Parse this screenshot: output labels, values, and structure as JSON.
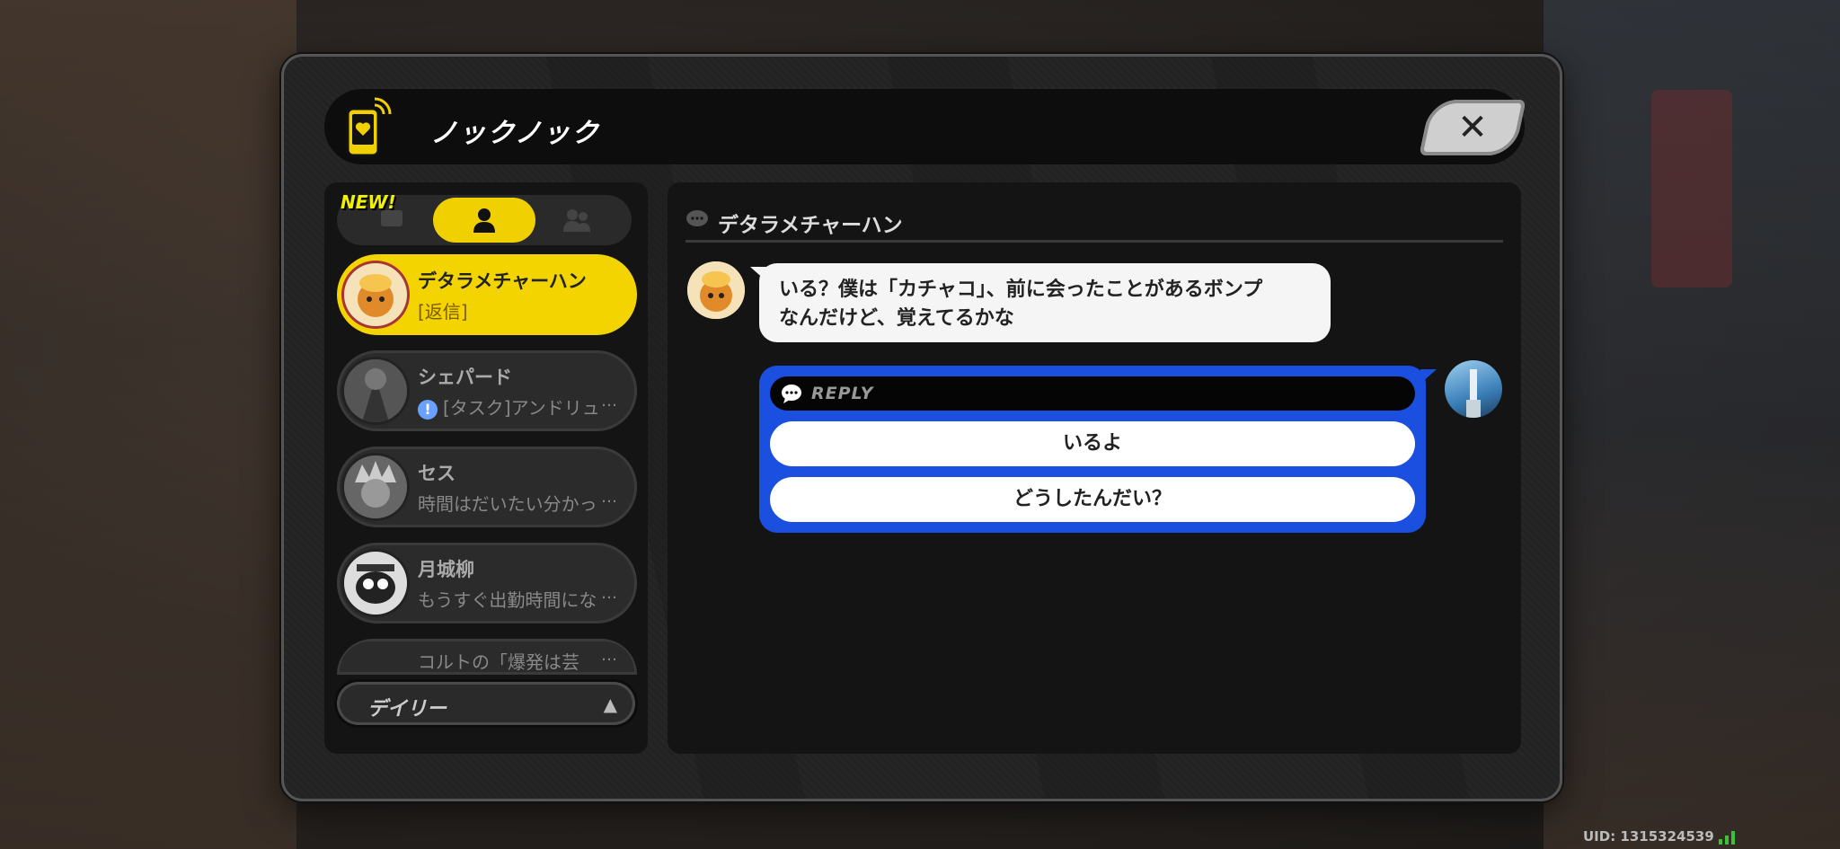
{
  "app": {
    "title": "ノックノック",
    "close_label": "✕"
  },
  "tabs": {
    "new_badge": "NEW!"
  },
  "contacts": [
    {
      "name": "デタラメチャーハン",
      "preview": "[返信]",
      "active": true
    },
    {
      "name": "シェパード",
      "preview": "[タスク]アンドリュ",
      "more": "…"
    },
    {
      "name": "セス",
      "preview": "時間はだいたい分かっ",
      "more": "…"
    },
    {
      "name": "月城柳",
      "preview": "もうすぐ出勤時間にな",
      "more": "…"
    },
    {
      "name": "",
      "preview": "コルトの「爆発は芸",
      "more": "…"
    }
  ],
  "filter": {
    "label": "デイリー",
    "arrow": "▲"
  },
  "chat": {
    "contact_name": "デタラメチャーハン",
    "message_line1": "いる？僕は「カチャコ」、前に会ったことがあるボンプ",
    "message_line2": "なんだけど、覚えてるかな",
    "reply_header": "REPLY",
    "reply_options": [
      "いるよ",
      "どうしたんだい？"
    ]
  },
  "footer": {
    "uid": "UID: 1315324539"
  },
  "colors": {
    "accent": "#f3d400",
    "reply_blue": "#1a4fe0"
  }
}
